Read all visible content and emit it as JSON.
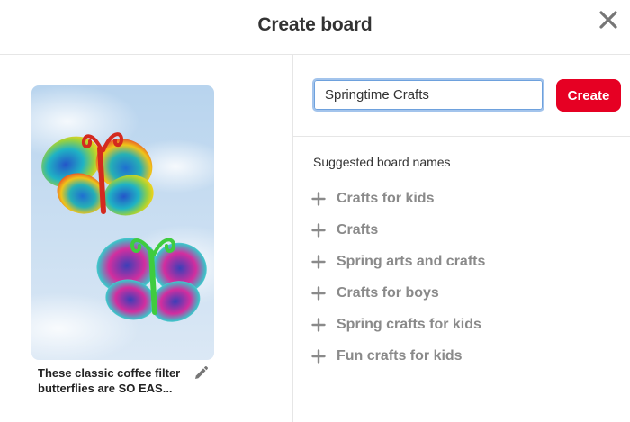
{
  "header": {
    "title": "Create board",
    "close_icon": "close-icon"
  },
  "pin": {
    "image_subject": "two tie-dyed coffee filter butterflies with pipe cleaner bodies on a sky background",
    "description": "These classic coffee filter butterflies are SO EAS...",
    "edit_icon": "pencil-icon"
  },
  "form": {
    "board_name_value": "Springtime Crafts",
    "create_label": "Create"
  },
  "suggestions": {
    "heading": "Suggested board names",
    "items": [
      {
        "label": "Crafts for kids"
      },
      {
        "label": "Crafts"
      },
      {
        "label": "Spring arts and crafts"
      },
      {
        "label": "Crafts for boys"
      },
      {
        "label": "Spring crafts for kids"
      },
      {
        "label": "Fun crafts for kids"
      }
    ]
  },
  "colors": {
    "accent": "#e60023",
    "input_focus_border": "#a3c4ec",
    "suggestion_text": "#8a8a8a"
  }
}
